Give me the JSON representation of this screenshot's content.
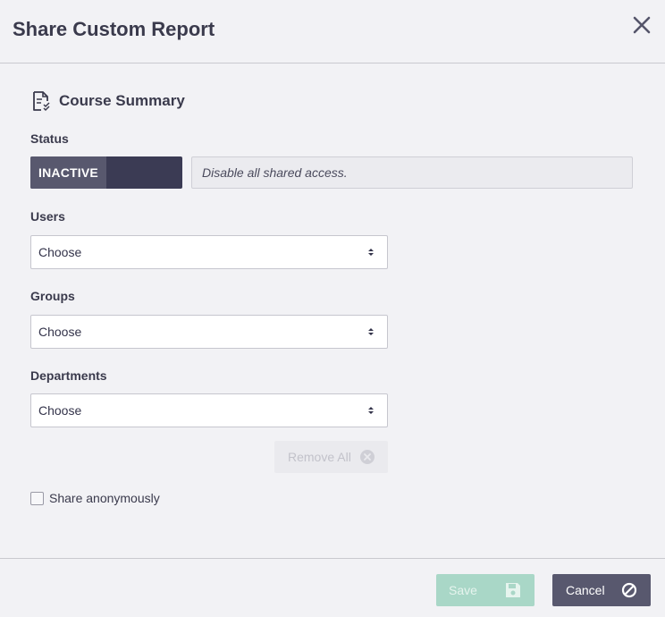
{
  "dialog": {
    "title": "Share Custom Report"
  },
  "report": {
    "name": "Course Summary"
  },
  "status": {
    "label": "Status",
    "toggle_label": "INACTIVE",
    "description": "Disable all shared access."
  },
  "users": {
    "label": "Users",
    "value": "Choose"
  },
  "groups": {
    "label": "Groups",
    "value": "Choose"
  },
  "departments": {
    "label": "Departments",
    "value": "Choose"
  },
  "remove_all": {
    "label": "Remove All"
  },
  "anonymous": {
    "label": "Share anonymously",
    "checked": false
  },
  "footer": {
    "save_label": "Save",
    "cancel_label": "Cancel"
  },
  "colors": {
    "background": "#f2f2f5",
    "toggle_dark": "#3b3b54",
    "toggle_label": "#58586e",
    "save_button": "#a9d7c7",
    "cancel_button": "#58586e"
  },
  "icons": {
    "close": "close-icon",
    "report": "report-icon",
    "select_arrow": "sort-arrows-icon",
    "remove": "remove-circle-icon",
    "save": "floppy-disk-icon",
    "cancel": "cancel-circle-icon"
  }
}
